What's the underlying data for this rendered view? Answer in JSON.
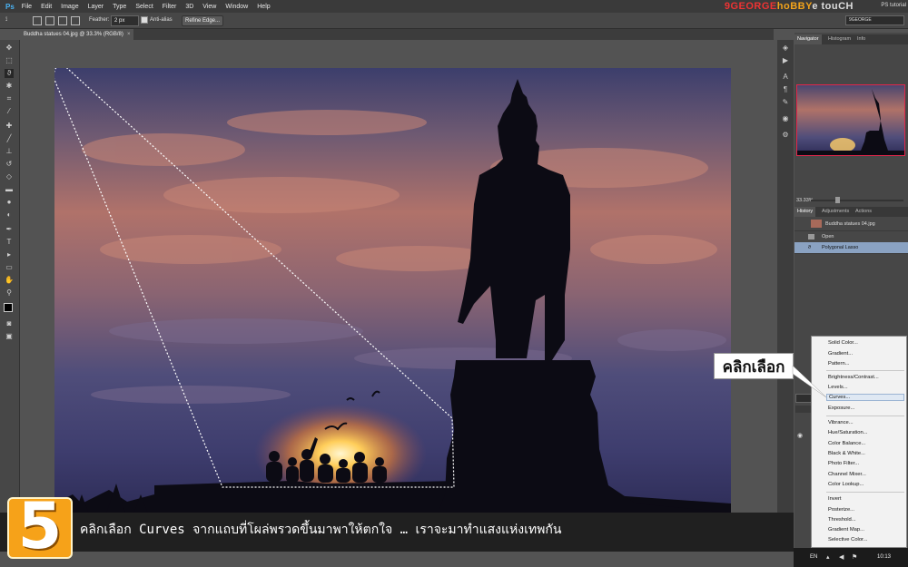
{
  "app": {
    "logo": "Ps",
    "menu": [
      "File",
      "Edit",
      "Image",
      "Layer",
      "Type",
      "Select",
      "Filter",
      "3D",
      "View",
      "Window",
      "Help"
    ]
  },
  "brand": {
    "g": "9GEORGE",
    "h": "hoBBY",
    "t": "e touCH",
    "ps_tutorial": "PS tutorial"
  },
  "workspace": "9GEORGE",
  "options": {
    "feather_label": "Feather:",
    "feather_value": "2 px",
    "antialias_label": "Anti-alias",
    "refine_edge": "Refine Edge..."
  },
  "document": {
    "tab_title": "Buddha statues 04.jpg @ 33.3% (RGB/8)"
  },
  "navigator": {
    "tabs": [
      "Navigator",
      "Histogram",
      "Info"
    ],
    "zoom": "33.33%"
  },
  "history": {
    "tabs": [
      "History",
      "Adjustments",
      "Actions"
    ],
    "snapshot": "Buddha statues 04.jpg",
    "items": [
      "Open",
      "Polygonal Lasso"
    ]
  },
  "context_menu": {
    "items": [
      "Solid Color...",
      "Gradient...",
      "Pattern...",
      "Brightness/Contrast...",
      "Levels...",
      "Curves...",
      "Exposure...",
      "Vibrance...",
      "Hue/Saturation...",
      "Color Balance...",
      "Black & White...",
      "Photo Filter...",
      "Channel Mixer...",
      "Color Lookup...",
      "Invert",
      "Posterize...",
      "Threshold...",
      "Gradient Map...",
      "Selective Color..."
    ],
    "highlighted": "Curves..."
  },
  "callout": "คลิกเลือก",
  "step_number": "5",
  "caption": "คลิกเลือก Curves จากแถบที่โผล่พรวดขึ้นมาพาให้ตกใจ … เราจะมาทำแสงแห่งเทพกัน",
  "taskbar": {
    "lang": "EN",
    "clock": "10:13"
  },
  "colors": {
    "accent_highlight": "#8aa2c2",
    "nav_frame": "#e3264a",
    "step_badge": "#f6a219"
  }
}
